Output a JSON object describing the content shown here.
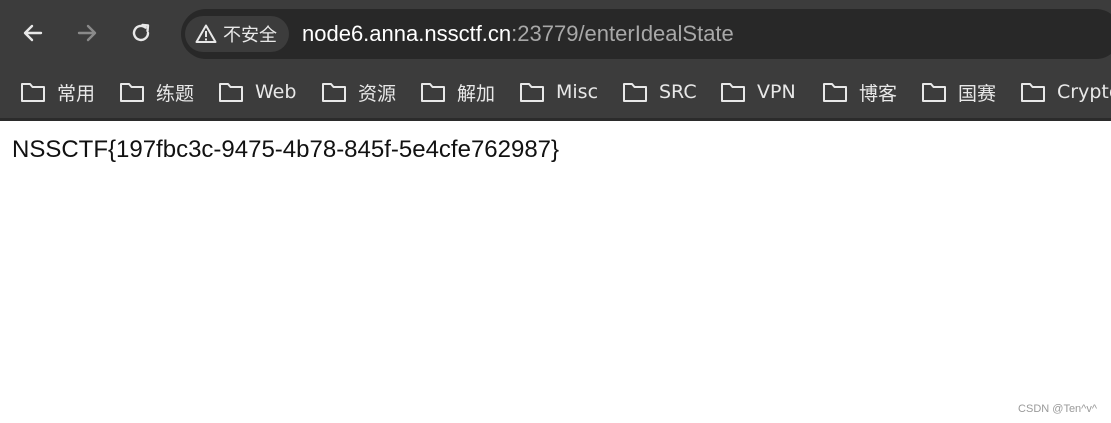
{
  "toolbar": {
    "back_icon": "arrow-left-icon",
    "forward_icon": "arrow-right-icon",
    "reload_icon": "reload-icon",
    "security_label": "不安全",
    "url_host": "node6.anna.nssctf.cn",
    "url_rest": ":23779/enterIdealState"
  },
  "bookmarks": [
    {
      "label": "常用"
    },
    {
      "label": "练题"
    },
    {
      "label": "Web"
    },
    {
      "label": "资源"
    },
    {
      "label": "解加"
    },
    {
      "label": "Misc"
    },
    {
      "label": "SRC"
    },
    {
      "label": "VPN"
    },
    {
      "label": "博客"
    },
    {
      "label": "国赛"
    },
    {
      "label": "Crypto"
    }
  ],
  "page": {
    "flag_text": "NSSCTF{197fbc3c-9475-4b78-845f-5e4cfe762987}",
    "watermark": "CSDN @Ten^v^"
  },
  "colors": {
    "toolbar_bg": "#3c3c3c",
    "omnibox_bg": "#282828",
    "page_bg": "#ffffff"
  }
}
